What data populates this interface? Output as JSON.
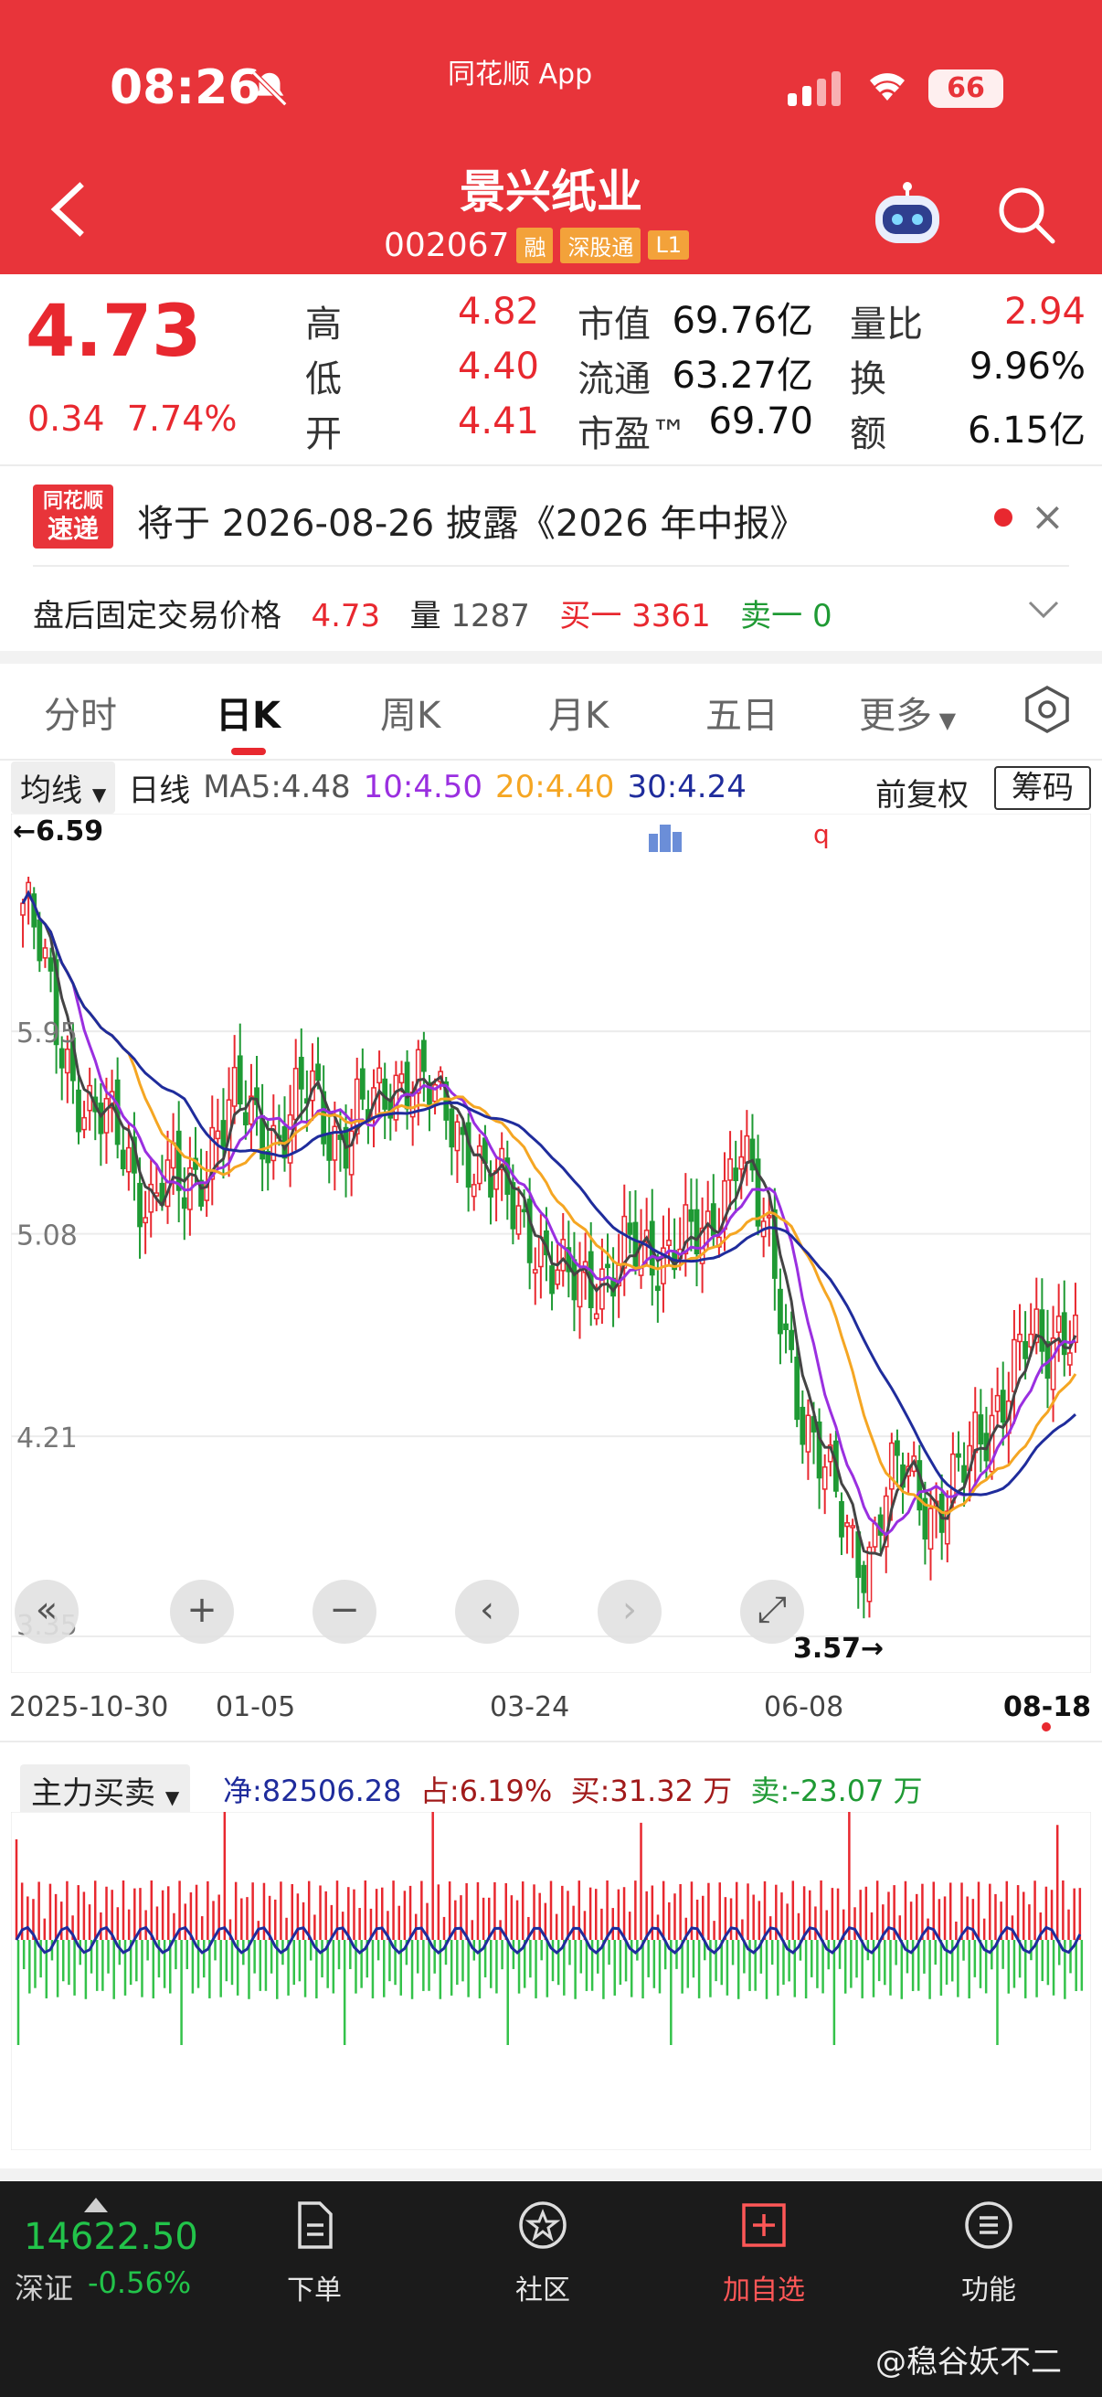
{
  "status": {
    "time": "08:26",
    "app_badge": "同花顺 App",
    "battery": "66"
  },
  "header": {
    "title": "景兴纸业",
    "code": "002067",
    "tags": [
      "融",
      "深股通",
      "L1"
    ]
  },
  "quote": {
    "price": "4.73",
    "change": "0.34",
    "change_pct": "7.74%",
    "high_label": "高",
    "high": "4.82",
    "low_label": "低",
    "low": "4.40",
    "open_label": "开",
    "open": "4.41",
    "mktcap_label": "市值",
    "mktcap": "69.76亿",
    "float_label": "流通",
    "float": "63.27亿",
    "pe_label": "市盈™",
    "pe": "69.70",
    "vr_label": "量比",
    "vr": "2.94",
    "turnover_label": "换",
    "turnover": "9.96%",
    "amount_label": "额",
    "amount": "6.15亿"
  },
  "notice": {
    "logo_top": "同花顺",
    "logo_bottom": "速递",
    "text": "将于 2026-08-26 披露《2026 年中报》"
  },
  "after_hours": {
    "label": "盘后固定交易价格",
    "price": "4.73",
    "vol_label": "量",
    "vol": "1287",
    "buy_label": "买一",
    "buy": "3361",
    "sell_label": "卖一",
    "sell": "0"
  },
  "tabs": [
    "分时",
    "日K",
    "周K",
    "月K",
    "五日",
    "更多"
  ],
  "active_tab": "日K",
  "ma": {
    "select": "均线",
    "period": "日线",
    "ma5": "MA5:4.48",
    "ma10": "10:4.50",
    "ma20": "20:4.40",
    "ma30": "30:4.24",
    "adjust": "前复权",
    "chips": "筹码"
  },
  "colors": {
    "up": "#e8282f",
    "down": "#1f9a34",
    "ma5": "#444444",
    "ma10": "#9a2fe0",
    "ma20": "#f5a623",
    "ma30": "#1f2c9c",
    "header": "#e8343a"
  },
  "chart_data": {
    "type": "candlestick",
    "y_ticks": [
      "5.95",
      "5.08",
      "4.21",
      "3.35"
    ],
    "x_ticks": [
      "2025-10-30",
      "01-05",
      "03-24",
      "06-08",
      "08-18"
    ],
    "max_label": "←6.59",
    "min_label": "3.57→",
    "ylim": [
      3.35,
      6.65
    ],
    "close_path": [
      6.5,
      6.3,
      6.0,
      5.8,
      5.6,
      5.55,
      5.5,
      5.35,
      5.2,
      5.3,
      5.25,
      5.35,
      5.5,
      5.6,
      5.6,
      5.55,
      5.5,
      5.6,
      5.7,
      5.55,
      5.5,
      5.6,
      5.6,
      5.7,
      5.8,
      5.75,
      5.6,
      5.55,
      5.45,
      5.35,
      5.25,
      5.15,
      5.1,
      4.95,
      4.85,
      4.85,
      4.9,
      4.95,
      5.0,
      4.95,
      5.0,
      5.1,
      5.05,
      5.0,
      5.3,
      5.55,
      5.2,
      4.9,
      4.6,
      4.3,
      4.1,
      3.9,
      3.75,
      3.7,
      3.95,
      4.05,
      4.0,
      3.9,
      3.95,
      4.05,
      4.2,
      4.35,
      4.5,
      4.6,
      4.55,
      4.7,
      4.73
    ]
  },
  "chart_controls": [
    "«",
    "+",
    "−",
    "‹",
    "›",
    "⤢"
  ],
  "money_flow": {
    "select": "主力买卖",
    "net": "净:82506.28",
    "ratio": "占:6.19%",
    "buy": "买:31.32 万",
    "sell": "卖:-23.07 万"
  },
  "bottom": {
    "index_value": "14622.50",
    "index_name": "深证",
    "index_change": "-0.56%",
    "items": [
      "下单",
      "社区",
      "加自选",
      "功能"
    ]
  },
  "watermark": "@稳谷妖不二"
}
